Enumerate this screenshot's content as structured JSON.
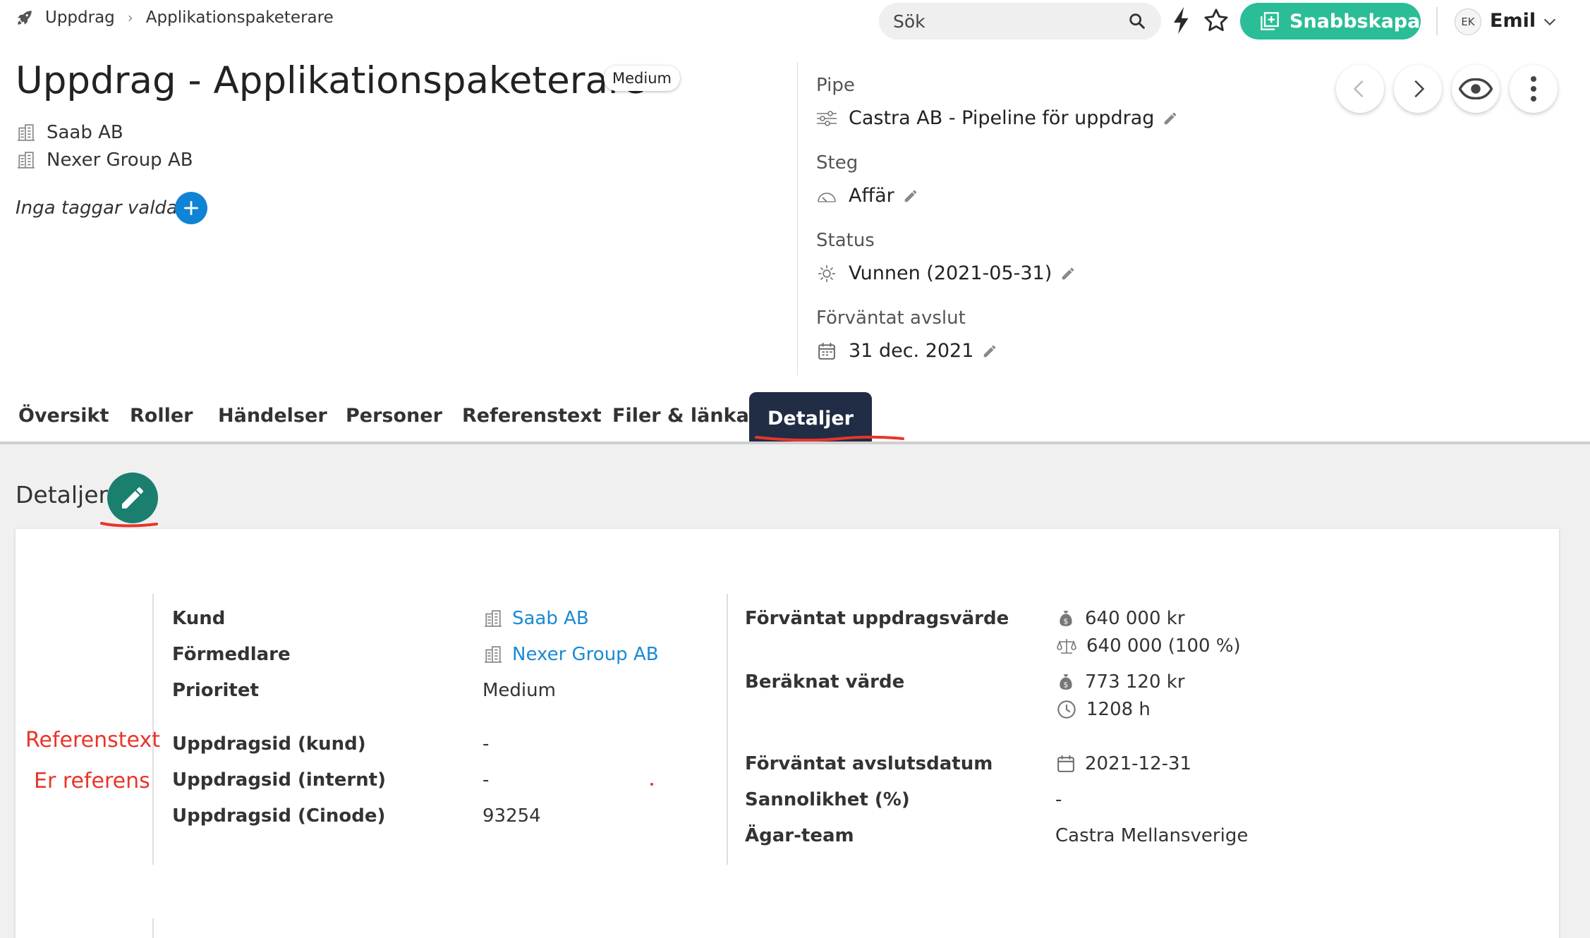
{
  "breadcrumb": {
    "root": "Uppdrag",
    "current": "Applikationspaketerare"
  },
  "search": {
    "placeholder": "Sök"
  },
  "quick_create": {
    "label": "Snabbskapa"
  },
  "user": {
    "initials": "EK",
    "name": "Emil"
  },
  "header": {
    "title": "Uppdrag - Applikationspaketerare",
    "priority_badge": "Medium",
    "organizations": [
      "Saab AB",
      "Nexer Group AB"
    ],
    "no_tags": "Inga taggar valda"
  },
  "meta": {
    "pipe_label": "Pipe",
    "pipe_value": "Castra AB - Pipeline för uppdrag",
    "step_label": "Steg",
    "step_value": "Affär",
    "status_label": "Status",
    "status_value": "Vunnen (2021-05-31)",
    "close_label": "Förväntat avslut",
    "close_value": "31 dec. 2021"
  },
  "tabs": [
    "Översikt",
    "Roller",
    "Händelser",
    "Personer",
    "Referenstext",
    "Filer & länkar",
    "Detaljer"
  ],
  "details": {
    "section_title": "Detaljer",
    "annotations": [
      "Referenstext",
      "Er referens"
    ],
    "left": [
      {
        "label": "Kund",
        "value": "Saab AB"
      },
      {
        "label": "Förmedlare",
        "value": "Nexer Group AB"
      },
      {
        "label": "Prioritet",
        "value": "Medium"
      },
      {
        "label": "Uppdragsid (kund)",
        "value": "-"
      },
      {
        "label": "Uppdragsid (internt)",
        "value": "-"
      },
      {
        "label": "Uppdragsid (Cinode)",
        "value": "93254"
      }
    ],
    "right": {
      "expected_value_label": "Förväntat uppdragsvärde",
      "expected_value": "640 000 kr",
      "expected_weighted": "640 000 (100 %)",
      "calculated_label": "Beräknat värde",
      "calculated_value": "773 120 kr",
      "calculated_hours": "1208 h",
      "close_date_label": "Förväntat avslutsdatum",
      "close_date": "2021-12-31",
      "probability_label": "Sannolikhet (%)",
      "probability": "-",
      "owner_team_label": "Ägar-team",
      "owner_team": "Castra Mellansverige"
    }
  },
  "colors": {
    "accent_green": "#2bbd95",
    "tab_active": "#202d44",
    "link": "#1a8ad4",
    "annotation_red": "#e8352a",
    "edit_button": "#1a7f6e",
    "add_button": "#0f84d6"
  }
}
